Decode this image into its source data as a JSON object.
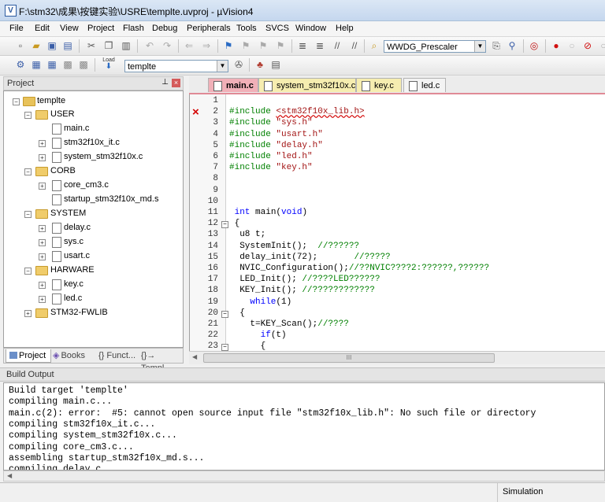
{
  "window": {
    "title": "F:\\stm32\\成果\\按键实验\\USRE\\templte.uvproj - µVision4",
    "app_icon": "uvision-icon"
  },
  "menu": [
    "File",
    "Edit",
    "View",
    "Project",
    "Flash",
    "Debug",
    "Peripherals",
    "Tools",
    "SVCS",
    "Window",
    "Help"
  ],
  "toolbar1": {
    "peripheral_combo": "WWDG_Prescaler"
  },
  "toolbar2": {
    "load_label": "Load",
    "target_combo": "templte"
  },
  "project_pane": {
    "title": "Project",
    "tree": [
      {
        "label": "templte",
        "kind": "root"
      },
      {
        "label": "USER",
        "kind": "folder"
      },
      {
        "label": "main.c",
        "kind": "file"
      },
      {
        "label": "stm32f10x_it.c",
        "kind": "file"
      },
      {
        "label": "system_stm32f10x.c",
        "kind": "file"
      },
      {
        "label": "CORB",
        "kind": "folder"
      },
      {
        "label": "core_cm3.c",
        "kind": "file"
      },
      {
        "label": "startup_stm32f10x_md.s",
        "kind": "file"
      },
      {
        "label": "SYSTEM",
        "kind": "folder"
      },
      {
        "label": "delay.c",
        "kind": "file"
      },
      {
        "label": "sys.c",
        "kind": "file"
      },
      {
        "label": "usart.c",
        "kind": "file"
      },
      {
        "label": "HARWARE",
        "kind": "folder"
      },
      {
        "label": "key.c",
        "kind": "file"
      },
      {
        "label": "led.c",
        "kind": "file"
      },
      {
        "label": "STM32-FWLIB",
        "kind": "folder"
      }
    ],
    "tabs": [
      "Project",
      "Books",
      "{} Funct...",
      "{}→ Templ..."
    ]
  },
  "editor": {
    "tabs": [
      "main.c",
      "system_stm32f10x.c",
      "key.c",
      "led.c"
    ],
    "line_numbers": [
      "1",
      "2",
      "3",
      "4",
      "5",
      "6",
      "7",
      "8",
      "9",
      "10",
      "11",
      "12",
      "13",
      "14",
      "15",
      "16",
      "17",
      "18",
      "19",
      "20",
      "21",
      "22",
      "23"
    ],
    "lines": [
      {
        "text": ""
      },
      {
        "pp": "#include ",
        "str": "<stm32f10x_lib.h>"
      },
      {
        "pp": "#include ",
        "str": "\"sys.h\""
      },
      {
        "pp": "#include ",
        "str": "\"usart.h\""
      },
      {
        "pp": "#include ",
        "str": "\"delay.h\""
      },
      {
        "pp": "#include ",
        "str": "\"led.h\""
      },
      {
        "pp": "#include ",
        "str": "\"key.h\""
      },
      {
        "text": ""
      },
      {
        "text": ""
      },
      {
        "text": ""
      },
      {
        "kw": " int ",
        "text": "main(",
        "kw2": "void",
        "text2": ")"
      },
      {
        "text": " {"
      },
      {
        "text": "  u8 t;"
      },
      {
        "text": "  SystemInit();  ",
        "cmt": "//??????"
      },
      {
        "text": "  delay_init(72);       ",
        "cmt": "//?????"
      },
      {
        "text": "  NVIC_Configuration();",
        "cmt": "//??NVIC????2:??????,??????"
      },
      {
        "text": "  LED_Init(); ",
        "cmt": "//????LED??????"
      },
      {
        "text": "  KEY_Init(); ",
        "cmt": "//????????????"
      },
      {
        "kw": "    while",
        "text": "(1)"
      },
      {
        "text": "  {"
      },
      {
        "text": "    t=KEY_Scan();",
        "cmt": "//????"
      },
      {
        "kw": "      if",
        "text": "(t)"
      },
      {
        "text": "      {"
      }
    ],
    "hscroll_grip": "III",
    "error_line_marker": "×"
  },
  "build_output": {
    "title": "Build Output",
    "lines": [
      "Build target 'templte'",
      "compiling main.c...",
      "main.c(2): error:  #5: cannot open source input file \"stm32f10x_lib.h\": No such file or directory",
      "compiling stm32f10x_it.c...",
      "compiling system_stm32f10x.c...",
      "compiling core_cm3.c...",
      "assembling startup_stm32f10x_md.s...",
      "compiling delay.c..."
    ]
  },
  "status": {
    "mode": "Simulation"
  },
  "colors": {
    "preprocessor": "#008000",
    "string": "#a31515",
    "keyword": "#0000ff",
    "comment": "#008000",
    "error": "#d40000"
  }
}
